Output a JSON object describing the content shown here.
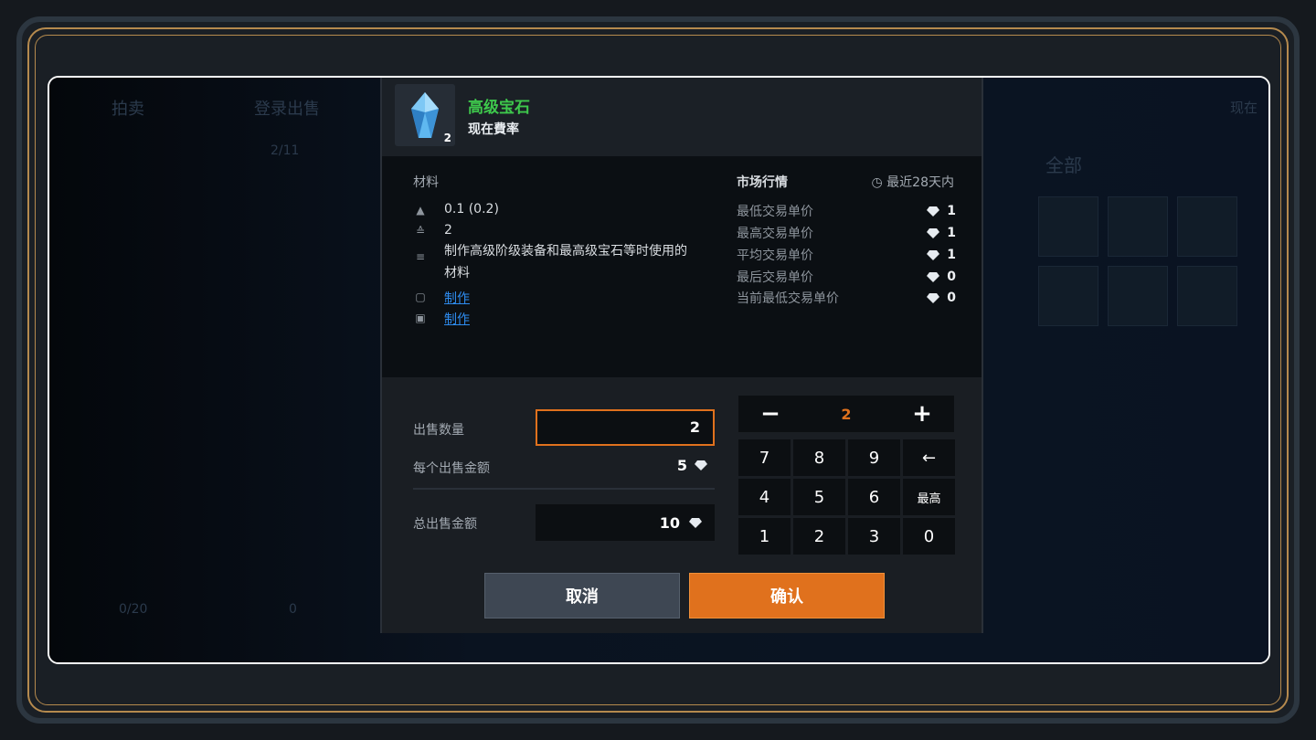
{
  "background": {
    "tab_left": "拍卖",
    "tab_register": "登录出售",
    "date_left": "2/11",
    "right_label": "现在",
    "filter_all": "全部",
    "footer_count": "0/20",
    "footer_diamond": "0"
  },
  "item": {
    "name": "高级宝石",
    "subtitle": "现在費率",
    "count": "2",
    "icon": "blue-gem-icon"
  },
  "info": {
    "title": "材料",
    "weight": "0.1 (0.2)",
    "stack": "2",
    "description": "制作高级阶级装备和最高级宝石等时使用的材料",
    "link1": "制作",
    "link2": "制作"
  },
  "market": {
    "title": "市场行情",
    "period": "最近28天内",
    "rows": [
      {
        "label": "最低交易单价",
        "value": "1"
      },
      {
        "label": "最高交易单价",
        "value": "1"
      },
      {
        "label": "平均交易单价",
        "value": "1"
      },
      {
        "label": "最后交易单价",
        "value": "0"
      },
      {
        "label": "当前最低交易单价",
        "value": "0"
      }
    ]
  },
  "sell": {
    "qty_label": "出售数量",
    "qty_value": "2",
    "unit_label": "每个出售金额",
    "unit_value": "5",
    "total_label": "总出售金额",
    "total_value": "10"
  },
  "stepper": {
    "minus": "−",
    "value": "2",
    "plus": "+"
  },
  "keypad": {
    "keys": [
      "7",
      "8",
      "9",
      "←",
      "4",
      "5",
      "6",
      "最高",
      "1",
      "2",
      "3",
      "0"
    ]
  },
  "buttons": {
    "cancel": "取消",
    "confirm": "确认"
  },
  "colors": {
    "accent": "#e0711d",
    "item_name": "#3ec84c",
    "link": "#2e8cf0"
  }
}
